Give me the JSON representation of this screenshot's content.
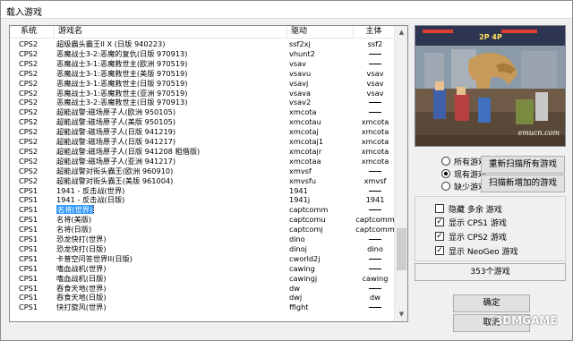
{
  "window": {
    "title": "载入游戏"
  },
  "columns": {
    "system": "系统",
    "name": "游戏名",
    "driver": "驱动",
    "parent": "主体"
  },
  "rows": [
    {
      "system": "CPS2",
      "name": "超级霸头霸王II X (日版 940223)",
      "driver": "ssf2xj",
      "parent": "ssf2"
    },
    {
      "system": "CPS2",
      "name": "恶魔战士3-2:恶魔的复仇(日版 970913)",
      "driver": "vhunt2",
      "parent": "—"
    },
    {
      "system": "CPS2",
      "name": "恶魔战士3-1:恶魔救世主(欧洲 970519)",
      "driver": "vsav",
      "parent": "—"
    },
    {
      "system": "CPS2",
      "name": "恶魔战士3-1:恶魔救世主(美版 970519)",
      "driver": "vsavu",
      "parent": "vsav"
    },
    {
      "system": "CPS2",
      "name": "恶魔战士3-1:恶魔救世主(日版 970519)",
      "driver": "vsavj",
      "parent": "vsav"
    },
    {
      "system": "CPS2",
      "name": "恶魔战士3-1:恶魔救世主(亚洲 970519)",
      "driver": "vsava",
      "parent": "vsav"
    },
    {
      "system": "CPS2",
      "name": "恶魔战士3-2:恶魔救世主(日版 970913)",
      "driver": "vsav2",
      "parent": "—"
    },
    {
      "system": "CPS2",
      "name": "超能战警:磁场原子人(欧洲 950105)",
      "driver": "xmcota",
      "parent": "—"
    },
    {
      "system": "CPS2",
      "name": "超能战警:磁场原子人(美版 950105)",
      "driver": "xmcotau",
      "parent": "xmcota"
    },
    {
      "system": "CPS2",
      "name": "超能战警:磁场原子人(日版 941219)",
      "driver": "xmcotaj",
      "parent": "xmcota"
    },
    {
      "system": "CPS2",
      "name": "超能战警:磁场原子人(日版 941217)",
      "driver": "xmcotaj1",
      "parent": "xmcota"
    },
    {
      "system": "CPS2",
      "name": "超能战警:磁场原子人(日版 941208 租借版)",
      "driver": "xmcotajr",
      "parent": "xmcota"
    },
    {
      "system": "CPS2",
      "name": "超能战警:磁场原子人(亚洲 941217)",
      "driver": "xmcotaa",
      "parent": "xmcota"
    },
    {
      "system": "CPS2",
      "name": "超能战警对街头霸王(欧洲 960910)",
      "driver": "xmvsf",
      "parent": "—"
    },
    {
      "system": "CPS2",
      "name": "超能战警对街头霸王(美版 961004)",
      "driver": "xmvsfu",
      "parent": "xmvsf"
    },
    {
      "system": "CPS1",
      "name": "1941 - 反击战(世界)",
      "driver": "1941",
      "parent": "—"
    },
    {
      "system": "CPS1",
      "name": "1941 - 反击战(日版)",
      "driver": "1941j",
      "parent": "1941"
    },
    {
      "system": "CPS1",
      "name": "名将(世界)",
      "driver": "captcomm",
      "parent": "—",
      "selected": true
    },
    {
      "system": "CPS1",
      "name": "名将(美版)",
      "driver": "captcomu",
      "parent": "captcomm"
    },
    {
      "system": "CPS1",
      "name": "名将(日版)",
      "driver": "captcomj",
      "parent": "captcomm"
    },
    {
      "system": "CPS1",
      "name": "恐龙快打(世界)",
      "driver": "dino",
      "parent": "—"
    },
    {
      "system": "CPS1",
      "name": "恐龙快打(日版)",
      "driver": "dinoj",
      "parent": "dino"
    },
    {
      "system": "CPS1",
      "name": "卡普空问答世界II(日版)",
      "driver": "cworld2j",
      "parent": "—"
    },
    {
      "system": "CPS1",
      "name": "嗜血战机(世界)",
      "driver": "cawing",
      "parent": "—"
    },
    {
      "system": "CPS1",
      "name": "嗜血战机(日版)",
      "driver": "cawingj",
      "parent": "cawing"
    },
    {
      "system": "CPS1",
      "name": "吞食天地(世界)",
      "driver": "dw",
      "parent": "—"
    },
    {
      "system": "CPS1",
      "name": "吞食天地(日版)",
      "driver": "dwj",
      "parent": "dw"
    },
    {
      "system": "CPS1",
      "name": "快打旋风(世界)",
      "driver": "ffight",
      "parent": "—"
    }
  ],
  "preview": {
    "site": "emucn.com",
    "hud": "2P  4P"
  },
  "filter_radios": [
    {
      "label": "所有游戏",
      "checked": false
    },
    {
      "label": "现有游戏",
      "checked": true
    },
    {
      "label": "缺少游戏",
      "checked": false
    }
  ],
  "buttons": {
    "rescan_all": "重新扫描所有游戏",
    "scan_new": "扫描新增加的游戏",
    "ok": "确定",
    "cancel": "取消"
  },
  "checkboxes": [
    {
      "label": "隐藏  多余 游戏",
      "checked": false
    },
    {
      "label": "显示  CPS1 游戏",
      "checked": true
    },
    {
      "label": "显示  CPS2 游戏",
      "checked": true
    },
    {
      "label": "显示  NeoGeo 游戏",
      "checked": true
    }
  ],
  "status": {
    "count": "353个游戏"
  },
  "watermark": "3DMGAME"
}
